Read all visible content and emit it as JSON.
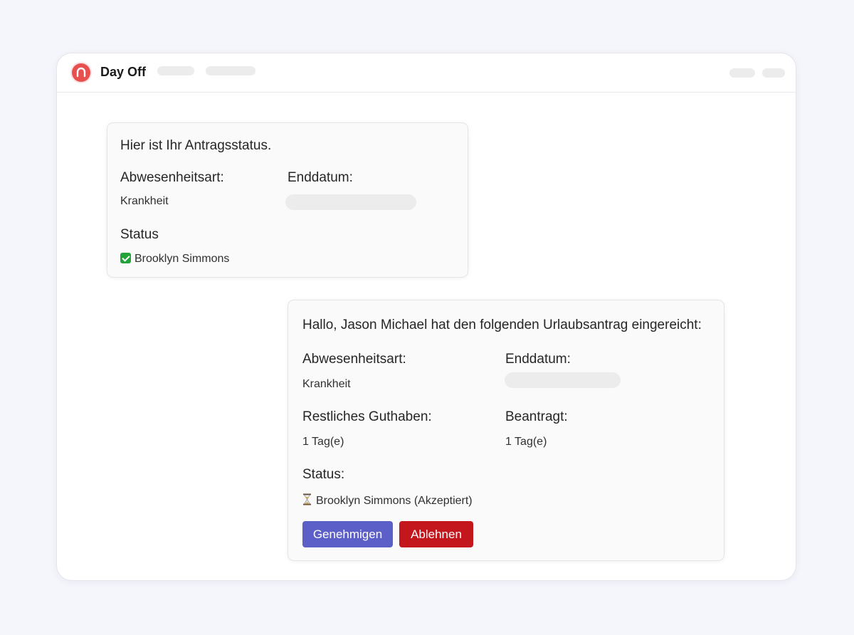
{
  "app": {
    "title": "Day Off"
  },
  "status_card": {
    "heading": "Hier ist Ihr Antragsstatus.",
    "absence_type_label": "Abwesenheitsart:",
    "absence_type_value": "Krankheit",
    "end_date_label": "Enddatum:",
    "status_label": "Status",
    "status_value": "Brooklyn Simmons"
  },
  "request_card": {
    "heading": "Hallo, Jason Michael hat den folgenden Urlaubsantrag eingereicht:",
    "absence_type_label": "Abwesenheitsart:",
    "absence_type_value": "Krankheit",
    "end_date_label": "Enddatum:",
    "remaining_label": "Restliches Guthaben:",
    "remaining_value": "1 Tag(e)",
    "requested_label": "Beantragt:",
    "requested_value": "1 Tag(e)",
    "status_label": "Status:",
    "status_value": "Brooklyn Simmons (Akzeptiert)",
    "approve_label": "Genehmigen",
    "reject_label": "Ablehnen"
  },
  "colors": {
    "approve": "#5b5fc7",
    "reject": "#c4161d",
    "logo": "#e8504f",
    "check": "#22a33a"
  }
}
